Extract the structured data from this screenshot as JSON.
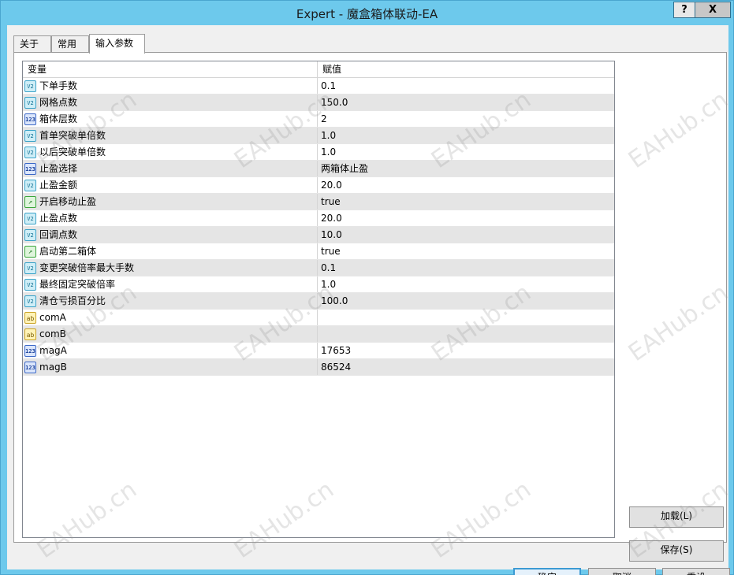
{
  "window": {
    "title": "Expert - 魔盒箱体联动-EA",
    "help_label": "?",
    "close_label": "X"
  },
  "tabs": [
    {
      "label": "关于"
    },
    {
      "label": "常用"
    },
    {
      "label": "输入参数"
    }
  ],
  "grid": {
    "headers": {
      "variable": "变量",
      "value": "赋值"
    },
    "rows": [
      {
        "icon": "double-type-icon",
        "name": "下单手数",
        "value": "0.1"
      },
      {
        "icon": "double-type-icon",
        "name": "网格点数",
        "value": "150.0"
      },
      {
        "icon": "int-type-icon",
        "name": "箱体层数",
        "value": "2"
      },
      {
        "icon": "double-type-icon",
        "name": "首单突破单倍数",
        "value": "1.0"
      },
      {
        "icon": "double-type-icon",
        "name": "以后突破单倍数",
        "value": "1.0"
      },
      {
        "icon": "int-type-icon",
        "name": "止盈选择",
        "value": "两箱体止盈"
      },
      {
        "icon": "double-type-icon",
        "name": "止盈金额",
        "value": "20.0"
      },
      {
        "icon": "bool-type-icon",
        "name": "开启移动止盈",
        "value": "true"
      },
      {
        "icon": "double-type-icon",
        "name": "止盈点数",
        "value": "20.0"
      },
      {
        "icon": "double-type-icon",
        "name": "回调点数",
        "value": "10.0"
      },
      {
        "icon": "bool-type-icon",
        "name": "启动第二箱体",
        "value": "true"
      },
      {
        "icon": "double-type-icon",
        "name": "变更突破倍率最大手数",
        "value": "0.1"
      },
      {
        "icon": "double-type-icon",
        "name": "最终固定突破倍率",
        "value": "1.0"
      },
      {
        "icon": "double-type-icon",
        "name": "清仓亏损百分比",
        "value": "100.0"
      },
      {
        "icon": "string-type-icon",
        "name": "comA",
        "value": ""
      },
      {
        "icon": "string-type-icon",
        "name": "comB",
        "value": ""
      },
      {
        "icon": "int-type-icon",
        "name": "magA",
        "value": "17653"
      },
      {
        "icon": "int-type-icon",
        "name": "magB",
        "value": "86524"
      }
    ]
  },
  "icon_glyphs": {
    "double-type-icon": "V2",
    "int-type-icon": "123",
    "bool-type-icon": "↗",
    "string-type-icon": "ab"
  },
  "buttons": {
    "load": "加载(L)",
    "save": "保存(S)",
    "ok": "确定",
    "cancel": "取消",
    "reset": "重设"
  },
  "watermark": "EAHub.cn"
}
